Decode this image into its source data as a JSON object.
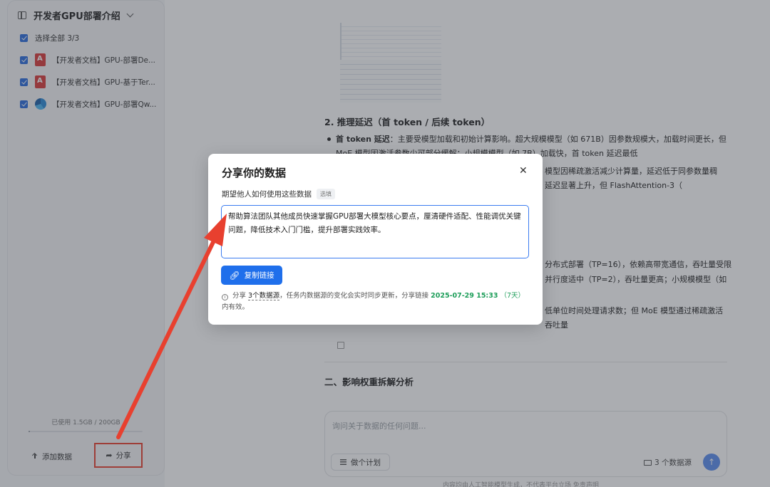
{
  "sidebar": {
    "title": "开发者GPU部署介绍",
    "select_all": "选择全部 3/3",
    "docs": [
      {
        "label": "【开发者文档】GPU-部署De...",
        "icon": "pdf-icon"
      },
      {
        "label": "【开发者文档】GPU-基于Ter...",
        "icon": "pdf-icon"
      },
      {
        "label": "【开发者文档】GPU-部署Qw...",
        "icon": "doc-icon"
      }
    ],
    "usage_text": "已使用 1.5GB / 200GB",
    "usage_fraction": 0.0075,
    "add_data_label": "添加数据",
    "share_label": "分享"
  },
  "content": {
    "heading_latency": "2. 推理延迟（首 token / 后续 token）",
    "bullet1_bold": "首 token 延迟",
    "bullet1_line1": "：主要受模型加载和初始计算影响。超大规模模型（如 671B）因参数规模大，加载时间更长，但",
    "bullet1_line2": "MoE 模型因激活参数少可部分缓解；小规模模型（如 7B）加载快，首 token 延迟最低",
    "bullet2_line1": "模型因稀疏激活减少计算量，延迟低于同参数量稠",
    "bullet2_line2": "延迟显著上升，但 FlashAttention-3（",
    "para3_line1": "分布式部署（TP=16），依赖高带宽通信，吞吐量受限",
    "para3_line2": "并行度适中（TP=2），吞吐量更高；小规模模型（如",
    "para4_line1": "低单位时间处理请求数；但 MoE 模型通过稀疏激活",
    "para4_line2": "吞吐量",
    "section_heading": "二、影响权重拆解分析",
    "chat_placeholder": "询问关于数据的任何问题...",
    "plan_button": "做个计划",
    "data_sources": "3 个数据源",
    "footer_note": "内容均由人工智能模型生成，不代表平台立场    免责声明"
  },
  "modal": {
    "title": "分享你的数据",
    "field_label": "期望他人如何使用这些数据",
    "optional_badge": "选填",
    "textarea_value": "帮助算法团队其他成员快速掌握GPU部署大模型核心要点，厘清硬件适配、性能调优关键问题，降低技术入门门槛，提升部署实践效率。",
    "copy_button": "复制链接",
    "info_prefix": "分享",
    "info_sources": "3个数据源",
    "info_middle": "，任务内数据源的变化会实时同步更新，分享链接",
    "info_date": "2025-07-29 15:33",
    "info_days": "（7天）",
    "info_suffix": "内有效。"
  },
  "colors": {
    "accent": "#1f6feb",
    "annotation": "#e8402f",
    "valid_date": "#1e9e5a"
  }
}
